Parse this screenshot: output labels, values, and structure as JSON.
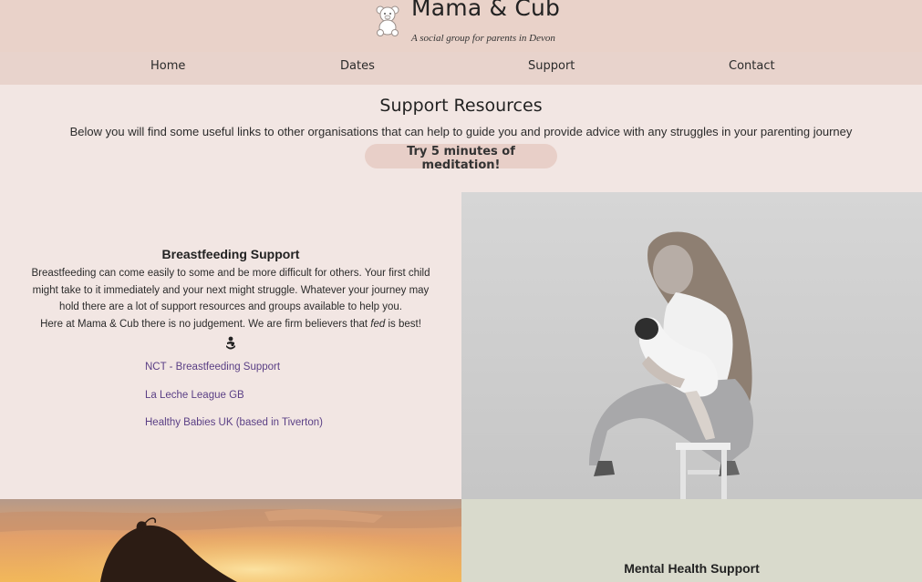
{
  "header": {
    "title": "Mama & Cub",
    "tagline": "A social group for parents in Devon",
    "logo_icon": "teddy-bear-icon"
  },
  "nav": {
    "items": [
      "Home",
      "Dates",
      "Support",
      "Contact"
    ]
  },
  "intro": {
    "title": "Support Resources",
    "text": "Below you will find some useful links to other organisations that can help to guide you and provide advice with any struggles in your parenting journey",
    "button_label": "Try 5 minutes of meditation!"
  },
  "breastfeeding": {
    "title": "Breastfeeding Support",
    "paragraph": "Breastfeeding can come easily to some and be more difficult for others. Your first child might take to it immediately and your next might struggle. Whatever your journey may hold there are a lot of support resources and groups available to help you.",
    "closing_before": "Here at Mama & Cub there is no judgement. We are firm believers that ",
    "closing_italic": "fed",
    "closing_after": " is best!",
    "icon": "breastfeeding-icon",
    "links": [
      "NCT - Breastfeeding Support",
      "La Leche League GB",
      "Healthy Babies UK (based in Tiverton)"
    ]
  },
  "mental_health": {
    "title": "Mental Health Support"
  },
  "colors": {
    "header_bg": "#e9d2c9",
    "page_bg": "#f2e6e3",
    "button_bg": "#e8cfc8",
    "link": "#5a3f85",
    "mental_health_bg": "#d9dacc"
  }
}
